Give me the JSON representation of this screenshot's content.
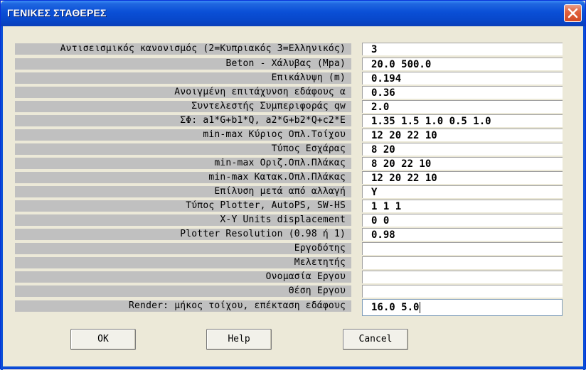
{
  "window": {
    "title": "ΓΕΝΙΚΕΣ ΣΤΑΘΕΡΕΣ",
    "accent_color": "#0a4fd6",
    "close_icon": "close-icon"
  },
  "fields": [
    {
      "label": "Αντισεισμικός κανονισμός (2=Κυπριακός 3=Ελληνικός)",
      "value": "3"
    },
    {
      "label": "Beton - Χάλυβας (Mpa)",
      "value": "20.0 500.0"
    },
    {
      "label": "Επικάλυψη (m)",
      "value": "0.194"
    },
    {
      "label": "Ανοιγμένη επιτάχυνση εδάφους α",
      "value": "0.36"
    },
    {
      "label": "Συντελεστής Συμπεριφοράς qw",
      "value": "2.0"
    },
    {
      "label": "ΣΦ: a1*G+b1*Q, a2*G+b2*Q+c2*E",
      "value": "1.35 1.5 1.0 0.5 1.0"
    },
    {
      "label": "min-max Κύριος Οπλ.Τοίχου",
      "value": "12 20 22 10"
    },
    {
      "label": "Τύπος Εσχάρας",
      "value": "8 20"
    },
    {
      "label": "min-max Οριζ.Οπλ.Πλάκας",
      "value": "8 20 22 10"
    },
    {
      "label": "min-max Κατακ.Οπλ.Πλάκας",
      "value": "12 20 22 10"
    },
    {
      "label": "Επίλυση μετά από αλλαγή",
      "value": "Y"
    },
    {
      "label": "Τύπος Plotter, AutoPS, SW-HS",
      "value": "1 1 1"
    },
    {
      "label": "X-Y Units displacement",
      "value": "0 0"
    },
    {
      "label": "Plotter Resolution (0.98 ή 1)",
      "value": "0.98"
    },
    {
      "label": "Εργοδότης",
      "value": ""
    },
    {
      "label": "Μελετητής",
      "value": ""
    },
    {
      "label": "Ονομασία Εργου",
      "value": ""
    },
    {
      "label": "Θέση Εργου",
      "value": ""
    },
    {
      "label": "Render: μήκος τοίχου, επέκταση εδάφους",
      "value": "16.0 5.0"
    }
  ],
  "buttons": {
    "ok": "OK",
    "help": "Help",
    "cancel": "Cancel"
  }
}
